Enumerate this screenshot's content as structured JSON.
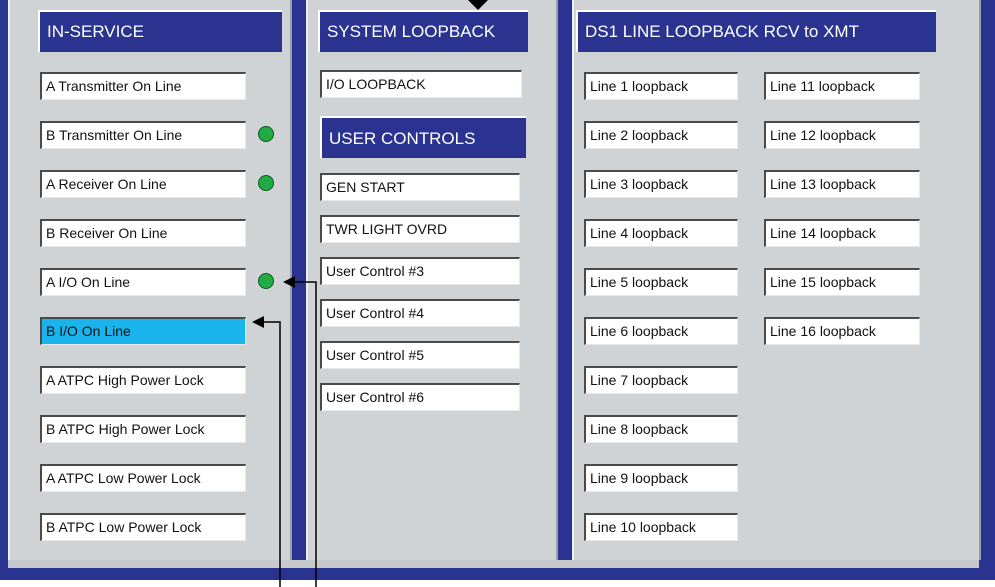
{
  "in_service": {
    "header": "IN-SERVICE",
    "items": [
      {
        "label": "A Transmitter On Line",
        "indicator": false,
        "selected": false
      },
      {
        "label": "B Transmitter On Line",
        "indicator": true,
        "selected": false
      },
      {
        "label": "A Receiver On Line",
        "indicator": true,
        "selected": false
      },
      {
        "label": "B Receiver On Line",
        "indicator": false,
        "selected": false
      },
      {
        "label": "A I/O On Line",
        "indicator": true,
        "selected": false
      },
      {
        "label": "B I/O On Line",
        "indicator": false,
        "selected": true
      },
      {
        "label": "A ATPC High Power Lock",
        "indicator": false,
        "selected": false
      },
      {
        "label": "B ATPC High Power Lock",
        "indicator": false,
        "selected": false
      },
      {
        "label": "A ATPC Low Power Lock",
        "indicator": false,
        "selected": false
      },
      {
        "label": "B ATPC Low Power Lock",
        "indicator": false,
        "selected": false
      }
    ]
  },
  "system_loopback": {
    "header": "SYSTEM LOOPBACK",
    "io_loopback_label": "I/O LOOPBACK"
  },
  "user_controls": {
    "header": "USER CONTROLS",
    "items": [
      {
        "label": "GEN START"
      },
      {
        "label": "TWR LIGHT OVRD"
      },
      {
        "label": "User Control #3"
      },
      {
        "label": "User Control #4"
      },
      {
        "label": "User Control #5"
      },
      {
        "label": "User Control #6"
      }
    ]
  },
  "ds1_loopback": {
    "header": "DS1 LINE LOOPBACK RCV to XMT",
    "left_column": [
      {
        "label": "Line 1 loopback"
      },
      {
        "label": "Line 2 loopback"
      },
      {
        "label": "Line 3 loopback"
      },
      {
        "label": "Line 4 loopback"
      },
      {
        "label": "Line 5 loopback"
      },
      {
        "label": "Line 6 loopback"
      },
      {
        "label": "Line 7 loopback"
      },
      {
        "label": "Line 8 loopback"
      },
      {
        "label": "Line 9 loopback"
      },
      {
        "label": "Line 10 loopback"
      }
    ],
    "right_column": [
      {
        "label": "Line 11 loopback"
      },
      {
        "label": "Line 12 loopback"
      },
      {
        "label": "Line 13 loopback"
      },
      {
        "label": "Line 14 loopback"
      },
      {
        "label": "Line 15 loopback"
      },
      {
        "label": "Line 16 loopback"
      }
    ]
  },
  "colors": {
    "frame": "#2a3490",
    "panel": "#d0d3d6",
    "selected": "#1ab4ec",
    "indicator_on": "#22aa44"
  }
}
